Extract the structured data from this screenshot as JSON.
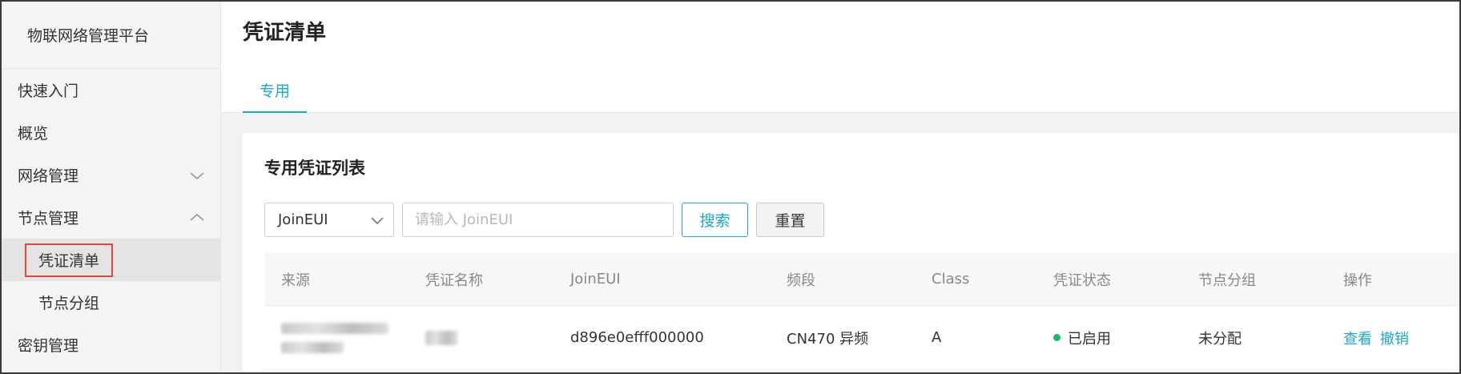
{
  "sidebar": {
    "brand": "物联网络管理平台",
    "items": [
      {
        "label": "快速入门"
      },
      {
        "label": "概览"
      },
      {
        "label": "网络管理",
        "icon": "chevron-down-icon"
      },
      {
        "label": "节点管理",
        "icon": "chevron-up-icon"
      },
      {
        "label": "凭证清单",
        "active": true
      },
      {
        "label": "节点分组"
      },
      {
        "label": "密钥管理"
      }
    ]
  },
  "header": {
    "title": "凭证清单"
  },
  "tabs": [
    {
      "label": "专用",
      "active": true
    }
  ],
  "list": {
    "title": "专用凭证列表",
    "filter": {
      "selected": "JoinEUI",
      "placeholder": "请输入 JoinEUI",
      "value": ""
    },
    "search_label": "搜索",
    "reset_label": "重置",
    "columns": [
      "来源",
      "凭证名称",
      "JoinEUI",
      "频段",
      "Class",
      "凭证状态",
      "节点分组",
      "操作"
    ],
    "rows": [
      {
        "source": "",
        "name": "",
        "joineui": "d896e0efff000000",
        "band": "CN470 异频",
        "class": "A",
        "status": "已启用",
        "group": "未分配",
        "actions": [
          "查看",
          "撤销"
        ]
      }
    ]
  },
  "colors": {
    "accent": "#1aa9c6",
    "status_on": "#1ab86b",
    "highlight": "#e0473a"
  }
}
